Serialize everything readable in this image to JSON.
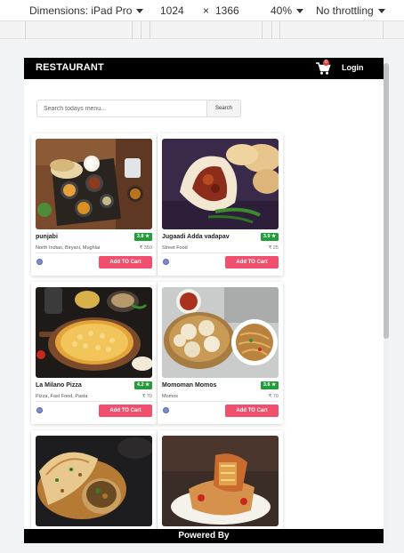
{
  "devtools": {
    "dimensions_label": "Dimensions: iPad Pro",
    "width": "1024",
    "times": "×",
    "height": "1366",
    "zoom": "40%",
    "throttling": "No throttling"
  },
  "navbar": {
    "brand": "RESTAURANT",
    "cart_count": "0",
    "login_label": "Login"
  },
  "search": {
    "placeholder": "Search todays menu...",
    "button_label": "Search"
  },
  "cards": [
    {
      "name": "punjabi",
      "rating": "3.8 ★",
      "cuisine": "North Indian, Biryani, Mughlai",
      "price": "₹ 350",
      "button": "Add TO Cart"
    },
    {
      "name": "Jugaadi Adda vadapav",
      "rating": "3.9 ★",
      "cuisine": "Street Food",
      "price": "₹ 25",
      "button": "Add TO Cart"
    },
    {
      "name": "La Milano Pizza",
      "rating": "4.2 ★",
      "cuisine": "Pizza, Fast Food, Pasta",
      "price": "₹ 70",
      "button": "Add TO Cart"
    },
    {
      "name": "Momoman Momos",
      "rating": "3.6 ★",
      "cuisine": "Momos",
      "price": "₹ 70",
      "button": "Add TO Cart"
    }
  ],
  "footer": {
    "text": "Powered By"
  },
  "colors": {
    "navbar": "#000000",
    "accent": "#f0506e",
    "rating": "#249c3b"
  }
}
